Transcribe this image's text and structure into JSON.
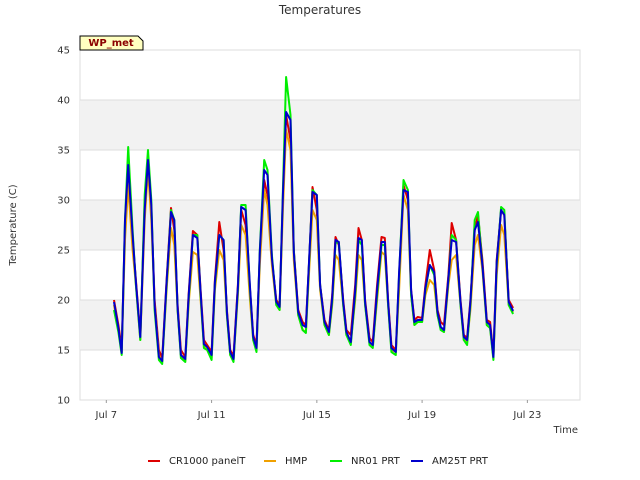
{
  "chart_data": {
    "type": "line",
    "title": "Temperatures",
    "xlabel": "Time",
    "ylabel": "Temperature (C)",
    "badge": "WP_met",
    "ylim": [
      10,
      45
    ],
    "xlim": [
      "2024-07-06",
      "2024-07-25"
    ],
    "yticks": [
      10,
      15,
      20,
      25,
      30,
      35,
      40,
      45
    ],
    "xticks": [
      {
        "date": "2024-07-07",
        "label": "Jul 7"
      },
      {
        "date": "2024-07-11",
        "label": "Jul 11"
      },
      {
        "date": "2024-07-15",
        "label": "Jul 15"
      },
      {
        "date": "2024-07-19",
        "label": "Jul 19"
      },
      {
        "date": "2024-07-23",
        "label": "Jul 23"
      }
    ],
    "grid": "horizontal bands",
    "legend_position": "bottom",
    "colors": {
      "background_band": "#f2f2f2",
      "gridline": "#dddddd",
      "badge_fill": "#ffffc0"
    },
    "x": [
      "2024-07-07 07:00",
      "2024-07-07 11:00",
      "2024-07-07 14:00",
      "2024-07-07 17:00",
      "2024-07-07 20:00",
      "2024-07-08 00:00",
      "2024-07-08 03:00",
      "2024-07-08 07:00",
      "2024-07-08 11:00",
      "2024-07-08 14:00",
      "2024-07-08 17:00",
      "2024-07-08 20:00",
      "2024-07-09 00:00",
      "2024-07-09 03:00",
      "2024-07-09 07:00",
      "2024-07-09 11:00",
      "2024-07-09 14:00",
      "2024-07-09 17:00",
      "2024-07-09 20:00",
      "2024-07-10 00:00",
      "2024-07-10 03:00",
      "2024-07-10 07:00",
      "2024-07-10 11:00",
      "2024-07-10 14:00",
      "2024-07-10 17:00",
      "2024-07-10 20:00",
      "2024-07-11 00:00",
      "2024-07-11 03:00",
      "2024-07-11 07:00",
      "2024-07-11 11:00",
      "2024-07-11 14:00",
      "2024-07-11 17:00",
      "2024-07-11 20:00",
      "2024-07-12 00:00",
      "2024-07-12 03:00",
      "2024-07-12 07:00",
      "2024-07-12 11:00",
      "2024-07-12 14:00",
      "2024-07-12 17:00",
      "2024-07-12 20:00",
      "2024-07-13 00:00",
      "2024-07-13 03:00",
      "2024-07-13 07:00",
      "2024-07-13 11:00",
      "2024-07-13 14:00",
      "2024-07-13 17:00",
      "2024-07-13 20:00",
      "2024-07-14 00:00",
      "2024-07-14 03:00",
      "2024-07-14 07:00",
      "2024-07-14 11:00",
      "2024-07-14 14:00",
      "2024-07-14 17:00",
      "2024-07-14 20:00",
      "2024-07-15 00:00",
      "2024-07-15 03:00",
      "2024-07-15 07:00",
      "2024-07-15 11:00",
      "2024-07-15 14:00",
      "2024-07-15 17:00",
      "2024-07-15 20:00",
      "2024-07-16 00:00",
      "2024-07-16 03:00",
      "2024-07-16 07:00",
      "2024-07-16 11:00",
      "2024-07-16 14:00",
      "2024-07-16 17:00",
      "2024-07-16 20:00",
      "2024-07-17 00:00",
      "2024-07-17 03:00",
      "2024-07-17 07:00",
      "2024-07-17 11:00",
      "2024-07-17 14:00",
      "2024-07-17 17:00",
      "2024-07-17 20:00",
      "2024-07-18 00:00",
      "2024-07-18 03:00",
      "2024-07-18 07:00",
      "2024-07-18 11:00",
      "2024-07-18 14:00",
      "2024-07-18 17:00",
      "2024-07-18 20:00",
      "2024-07-19 00:00",
      "2024-07-19 03:00",
      "2024-07-19 07:00",
      "2024-07-19 11:00",
      "2024-07-19 14:00",
      "2024-07-19 17:00",
      "2024-07-19 20:00",
      "2024-07-20 00:00",
      "2024-07-20 03:00",
      "2024-07-20 07:00",
      "2024-07-20 11:00",
      "2024-07-20 14:00",
      "2024-07-20 17:00",
      "2024-07-20 20:00",
      "2024-07-21 00:00",
      "2024-07-21 03:00",
      "2024-07-21 07:00",
      "2024-07-21 11:00",
      "2024-07-21 14:00",
      "2024-07-21 17:00",
      "2024-07-21 20:00",
      "2024-07-22 00:00",
      "2024-07-22 03:00",
      "2024-07-22 07:00",
      "2024-07-22 11:00",
      "2024-07-22 14:00",
      "2024-07-22 17:00",
      "2024-07-22 20:00",
      "2024-07-23 00:00",
      "2024-07-23 03:00",
      "2024-07-23 07:00",
      "2024-07-23 11:00",
      "2024-07-23 14:00",
      "2024-07-23 17:00",
      "2024-07-23 20:00",
      "2024-07-24 00:00",
      "2024-07-24 03:00",
      "2024-07-24 07:00",
      "2024-07-24 11:00",
      "2024-07-24 14:00",
      "2024-07-24 17:00",
      "2024-07-24 20:00",
      "2024-07-25 00:00"
    ],
    "series": [
      {
        "name": "CR1000 panelT",
        "color": "#dd0000",
        "values": [
          20.0,
          17.5,
          15.2,
          27.0,
          33.8,
          26.0,
          22.0,
          16.5,
          29.5,
          34.0,
          29.0,
          20.0,
          15.0,
          14.2,
          22.0,
          29.2,
          27.0,
          19.5,
          15.0,
          14.3,
          20.5,
          26.9,
          26.5,
          21.0,
          16.0,
          15.5,
          14.8,
          22.0,
          27.8,
          25.0,
          19.0,
          15.0,
          14.4,
          21.5,
          29.0,
          27.5,
          21.0,
          16.5,
          15.5,
          24.5,
          32.0,
          30.5,
          24.0,
          20.0,
          19.5,
          30.0,
          38.5,
          36.0,
          25.0,
          19.0,
          17.8,
          17.5,
          24.0,
          31.3,
          29.0,
          21.5,
          18.0,
          17.0,
          20.5,
          26.3,
          25.5,
          20.0,
          17.0,
          16.5,
          21.5,
          27.2,
          26.0,
          20.0,
          16.2,
          15.8,
          21.5,
          26.3,
          26.2,
          20.0,
          15.5,
          15.0,
          22.0,
          31.5,
          30.0,
          21.0,
          18.0,
          18.3,
          18.2,
          21.5,
          25.0,
          23.0,
          19.0,
          17.8,
          17.5,
          22.5,
          27.7,
          26.0,
          20.0,
          16.5,
          16.2,
          20.0,
          27.0,
          28.5,
          24.0,
          18.0,
          17.8,
          14.5,
          24.0,
          29.0,
          28.5,
          20.0,
          19.2
        ]
      },
      {
        "name": "HMP",
        "color": "#f0a000",
        "values": [
          19.5,
          17.0,
          14.8,
          26.0,
          31.5,
          25.0,
          21.5,
          16.0,
          28.0,
          33.0,
          28.0,
          19.5,
          14.5,
          13.8,
          21.0,
          27.2,
          25.5,
          19.0,
          14.5,
          13.9,
          19.5,
          24.8,
          24.5,
          20.0,
          15.5,
          15.0,
          14.2,
          21.0,
          25.0,
          24.0,
          18.5,
          14.5,
          14.0,
          20.5,
          27.5,
          26.5,
          20.0,
          16.0,
          15.0,
          23.5,
          31.0,
          29.5,
          23.5,
          19.5,
          19.0,
          29.0,
          37.0,
          35.0,
          24.0,
          18.5,
          17.0,
          16.8,
          23.0,
          29.0,
          28.0,
          21.0,
          17.5,
          16.5,
          19.5,
          24.5,
          24.0,
          19.5,
          16.5,
          15.8,
          20.0,
          24.5,
          24.0,
          19.5,
          15.8,
          15.4,
          20.0,
          24.8,
          24.5,
          19.5,
          15.0,
          14.8,
          21.0,
          30.5,
          29.0,
          20.5,
          17.5,
          17.8,
          17.8,
          20.5,
          22.0,
          21.5,
          18.5,
          17.2,
          16.8,
          21.5,
          24.0,
          24.5,
          19.5,
          16.0,
          15.8,
          19.0,
          25.5,
          26.5,
          23.0,
          17.5,
          17.2,
          14.2,
          22.5,
          27.5,
          26.5,
          19.5,
          18.8
        ]
      },
      {
        "name": "NR01 PRT",
        "color": "#00ee00",
        "values": [
          19.0,
          16.8,
          14.5,
          28.0,
          35.3,
          27.0,
          21.5,
          16.0,
          30.5,
          35.0,
          30.0,
          19.0,
          14.0,
          13.6,
          21.5,
          29.0,
          28.0,
          19.0,
          14.2,
          13.8,
          20.0,
          26.5,
          26.5,
          20.5,
          15.2,
          15.0,
          14.0,
          21.5,
          26.5,
          26.0,
          18.5,
          14.5,
          13.8,
          21.0,
          29.5,
          29.5,
          21.0,
          16.0,
          14.8,
          25.0,
          34.0,
          33.0,
          24.5,
          19.5,
          19.0,
          31.0,
          42.3,
          38.5,
          25.0,
          18.5,
          17.0,
          16.7,
          24.0,
          31.0,
          30.5,
          21.5,
          17.5,
          16.5,
          19.8,
          25.7,
          25.8,
          19.5,
          16.5,
          15.5,
          20.5,
          26.0,
          25.5,
          19.5,
          15.5,
          15.2,
          20.5,
          25.5,
          25.5,
          19.5,
          14.8,
          14.5,
          22.5,
          32.0,
          31.0,
          20.5,
          17.5,
          17.8,
          17.8,
          21.0,
          23.5,
          22.5,
          18.5,
          17.0,
          16.8,
          22.0,
          26.5,
          26.0,
          19.5,
          16.0,
          15.5,
          19.5,
          28.0,
          28.8,
          23.5,
          17.5,
          17.2,
          14.0,
          23.5,
          29.3,
          29.0,
          19.5,
          18.6
        ]
      },
      {
        "name": "AM25T PRT",
        "color": "#0000cc",
        "values": [
          19.8,
          17.2,
          14.7,
          28.0,
          33.5,
          26.5,
          21.8,
          16.3,
          29.0,
          34.0,
          29.5,
          19.5,
          14.3,
          13.9,
          21.8,
          28.8,
          28.0,
          19.2,
          14.5,
          14.1,
          20.3,
          26.5,
          26.2,
          20.8,
          15.6,
          15.3,
          14.5,
          21.8,
          26.5,
          26.0,
          18.8,
          14.8,
          14.1,
          21.3,
          29.3,
          29.0,
          21.3,
          16.3,
          15.2,
          24.8,
          33.0,
          32.5,
          24.2,
          19.8,
          19.3,
          30.5,
          38.8,
          38.0,
          24.8,
          18.8,
          17.5,
          17.3,
          24.2,
          30.8,
          30.5,
          21.5,
          17.8,
          16.8,
          20.2,
          26.0,
          25.8,
          19.8,
          16.8,
          15.8,
          21.0,
          26.2,
          26.0,
          19.8,
          15.8,
          15.5,
          21.0,
          25.8,
          25.8,
          19.8,
          15.2,
          14.8,
          22.8,
          31.0,
          30.8,
          21.0,
          17.8,
          18.0,
          18.0,
          21.2,
          23.5,
          22.8,
          18.8,
          17.3,
          17.0,
          22.2,
          26.0,
          25.8,
          19.8,
          16.3,
          16.0,
          19.8,
          27.0,
          27.8,
          23.5,
          17.8,
          17.5,
          14.3,
          23.8,
          29.0,
          28.5,
          19.8,
          18.9
        ]
      }
    ]
  }
}
